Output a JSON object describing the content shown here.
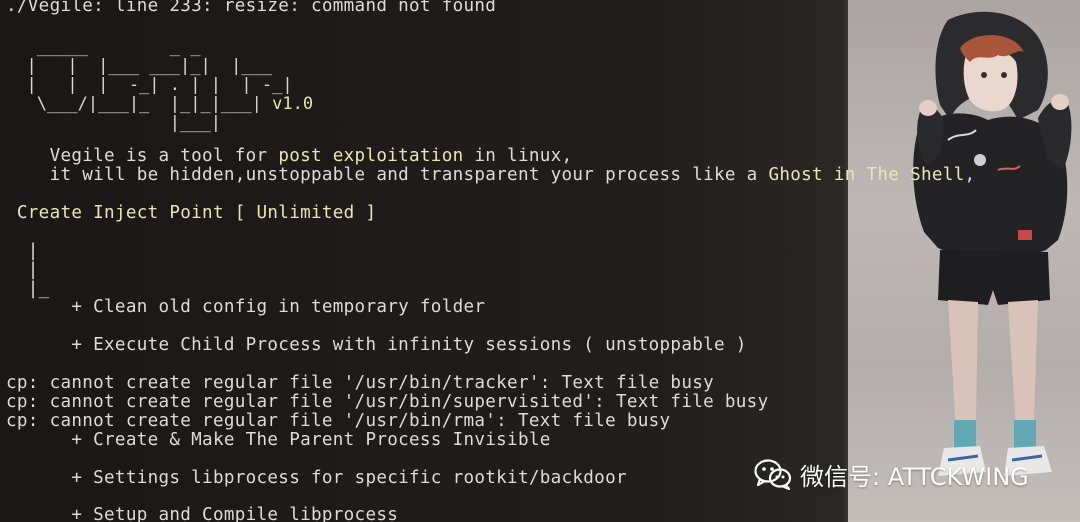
{
  "terminal": {
    "error_line": "./Vegile: line 233: resize: command not found",
    "banner": {
      "art_line_1": "   _____        _ _",
      "art_line_2": "  |   |  |___ ___|_|  |___",
      "art_line_3": "  |   |  |  -_| . | |  | -_|",
      "art_line_4": "   \\___/|___|_  |_|_|___| ",
      "art_line_5": "                |___|",
      "version": "v1.0"
    },
    "description": {
      "line1_a": "    Vegile is a tool for ",
      "line1_b": "post exploitation",
      "line1_c": " in linux,",
      "line2_a": "    it will be hidden,unstoppable and transparent your process like a ",
      "line2_b": "Ghost in The Shell",
      "line2_c": ","
    },
    "inject_point": " Create Inject Point [ Unlimited ]",
    "tree": {
      "pipe1": "  |",
      "pipe2": "  |",
      "pipe3": "  |_"
    },
    "steps": {
      "clean": "      + Clean old config in temporary folder",
      "execute": "      + Execute Child Process with infinity sessions ( unstoppable )",
      "invisible": "      + Create & Make The Parent Process Invisible",
      "settings": "      + Settings libprocess for specific rootkit/backdoor",
      "setup": "      + Setup and Compile libprocess"
    },
    "cp_errors": [
      "cp: cannot create regular file '/usr/bin/tracker': Text file busy",
      "cp: cannot create regular file '/usr/bin/supervisited': Text file busy",
      "cp: cannot create regular file '/usr/bin/rma': Text file busy"
    ]
  },
  "watermark": {
    "text": "微信号: ATTCKWING",
    "icon": "wechat-icon"
  },
  "colors": {
    "terminal_bg": "#1f1c1a",
    "text": "#dcdcdc",
    "highlight": "#e6e8b0",
    "watermark": "#ffffff"
  }
}
